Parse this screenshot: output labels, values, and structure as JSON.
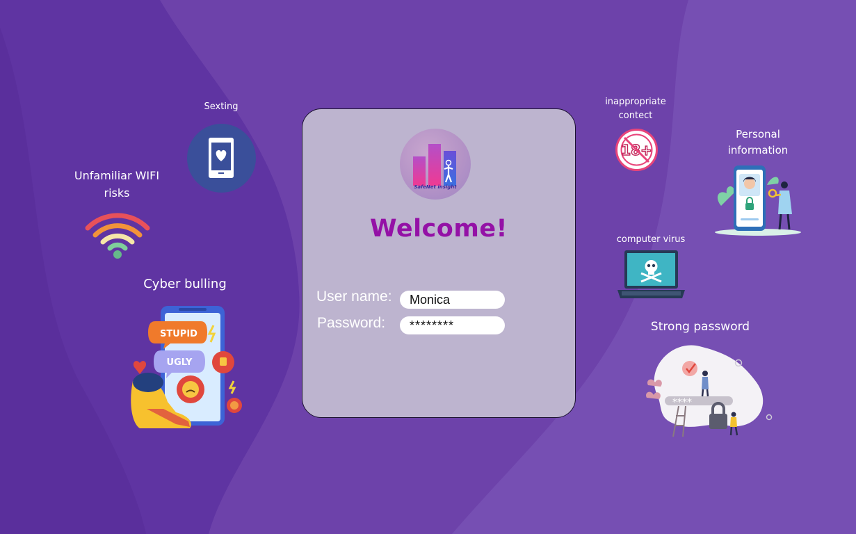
{
  "topics": {
    "sexting": "Sexting",
    "wifi_line1": "Unfamiliar WIFI",
    "wifi_line2": "risks",
    "cyberbullying": "Cyber bulling",
    "inappropriate_line1": "inappropriate",
    "inappropriate_line2": "contect",
    "personal_line1": "Personal",
    "personal_line2": "information",
    "virus": "computer virus",
    "strong_password": "Strong password"
  },
  "illustration_text": {
    "bubble_stupid": "STUPID",
    "bubble_ugly": "UGLY",
    "age_badge": "18+",
    "password_mask": "****"
  },
  "login": {
    "logo_text": "SafeNet insight",
    "welcome": "Welcome!",
    "username_label": "User name:",
    "username_value": "Monica",
    "password_label": "Password:",
    "password_value": "********"
  },
  "colors": {
    "background": "#6d42aa",
    "card": "#bdb4cf",
    "welcome": "#9411a6"
  }
}
